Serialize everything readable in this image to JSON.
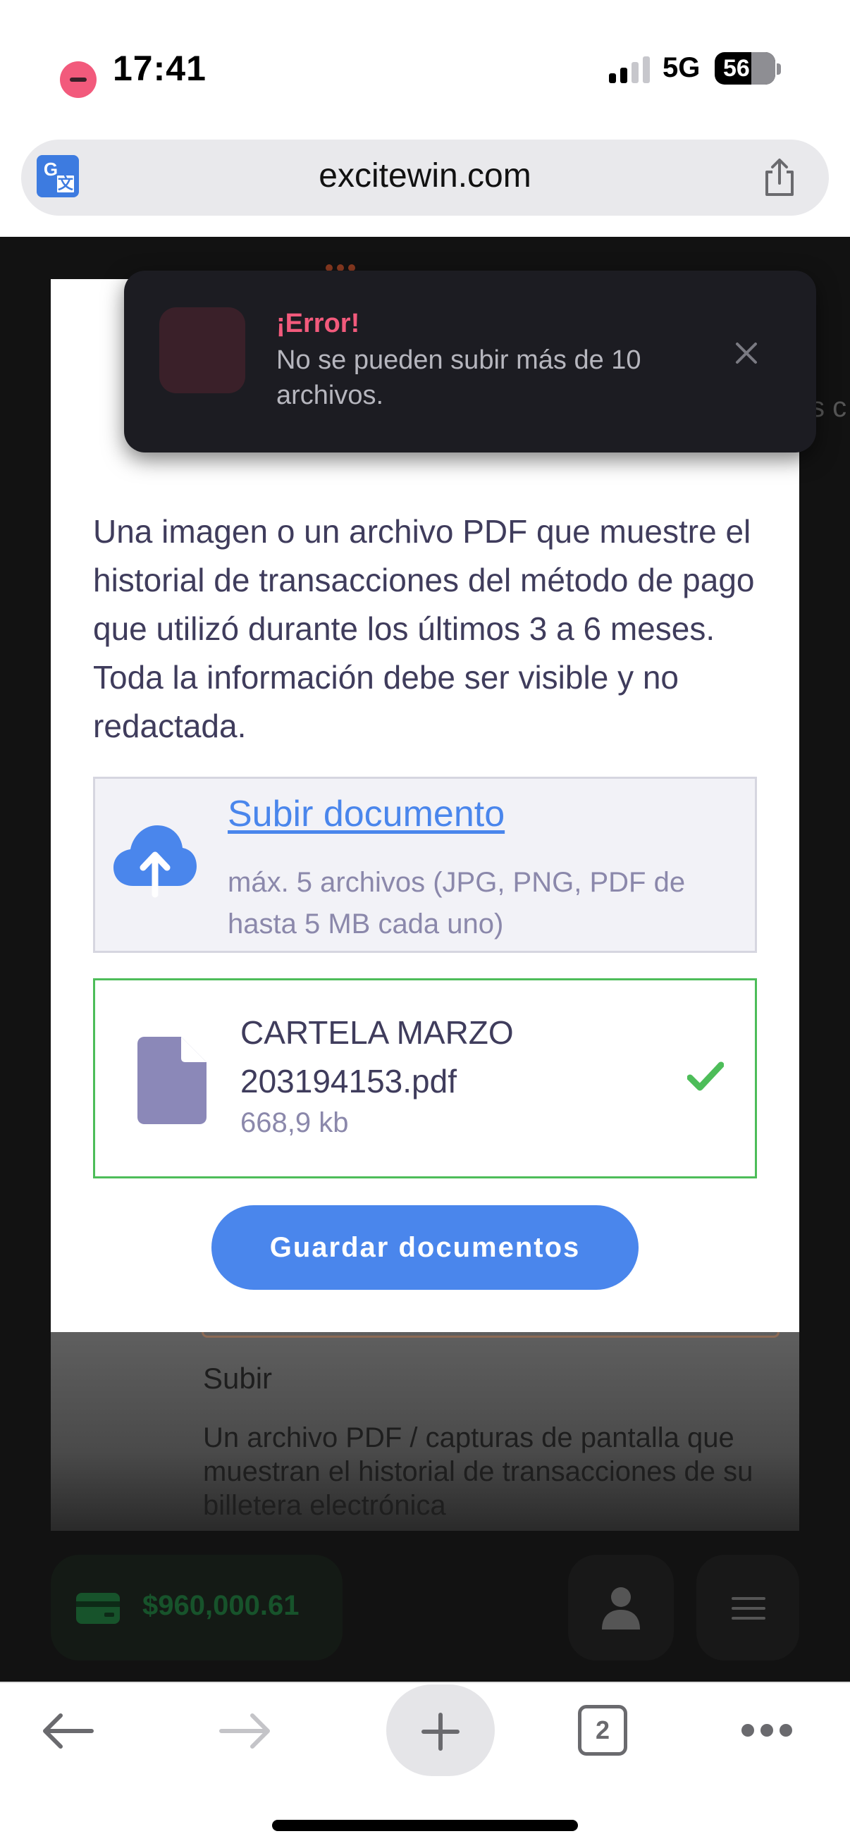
{
  "status_bar": {
    "time": "17:41",
    "network": "5G",
    "battery": "56"
  },
  "browser": {
    "url": "excitewin.com",
    "tab_count": "2",
    "icons": {
      "translate": "translate-icon",
      "share": "share-icon",
      "back": "back-arrow-icon",
      "forward": "forward-arrow-icon",
      "new_tab": "plus-icon",
      "tabs": "tabs-icon",
      "more": "more-icon"
    }
  },
  "toast": {
    "title": "¡Error!",
    "message": "No se pueden subir más de 10 archivos.",
    "colors": {
      "accent": "#f25a7c",
      "background": "#1c1c22"
    }
  },
  "modal": {
    "description": "Una imagen o un archivo PDF que muestre el historial de transacciones del método de pago que utilizó durante los últimos 3 a 6 meses. Toda la información debe ser visible y no redactada.",
    "upload": {
      "link_label": "Subir documento",
      "hint": "máx. 5 archivos (JPG, PNG, PDF de hasta 5 MB cada uno)"
    },
    "file": {
      "name": "CARTELA MARZO 203194153.pdf",
      "size": "668,9 kb",
      "status": "uploaded"
    },
    "save_button": "Guardar documentos",
    "colors": {
      "primary": "#4a86ec",
      "success": "#4dbd59",
      "text": "#3f3c5c"
    }
  },
  "background_content": {
    "title": "Subir",
    "description": "Un archivo PDF / capturas de pantalla que muestran el historial de transacciones de su billetera electrónica"
  },
  "footer": {
    "balance": "$960,000.61"
  }
}
